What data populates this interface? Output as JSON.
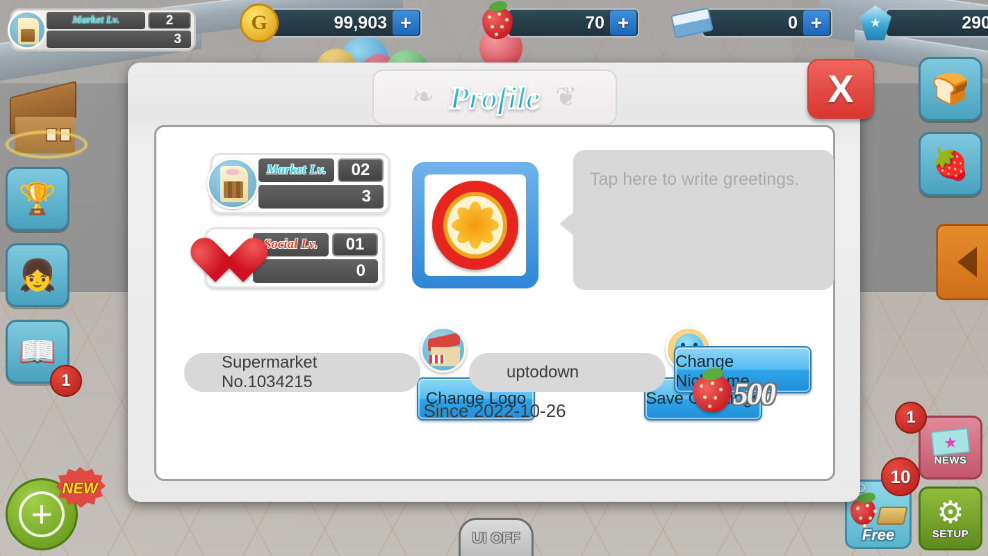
{
  "hud": {
    "market": {
      "label": "Market Lv.",
      "level": "2",
      "progress": "3",
      "icon": "shopping-bag-icon"
    },
    "currencies": [
      {
        "name": "gold",
        "icon": "gold-coin-icon",
        "value": "99,903",
        "plus": "+"
      },
      {
        "name": "strawberry",
        "icon": "strawberry-icon",
        "value": "70",
        "plus": "+"
      },
      {
        "name": "ticket",
        "icon": "ticket-icon",
        "value": "0",
        "plus": "+"
      },
      {
        "name": "gem",
        "icon": "gem-icon",
        "value": "290"
      }
    ]
  },
  "sidebar_left": [
    {
      "name": "trophy",
      "icon": "trophy-icon",
      "glyph": "🏆"
    },
    {
      "name": "character",
      "icon": "character-icon",
      "glyph": "👧"
    },
    {
      "name": "catalog",
      "icon": "catalog-book-icon",
      "glyph": "📖",
      "badge": "1"
    }
  ],
  "sidebar_right": [
    {
      "name": "bread",
      "icon": "bread-icon",
      "glyph": "🍞"
    },
    {
      "name": "strawberry-girl",
      "icon": "strawberry-girl-icon",
      "glyph": "🍓"
    }
  ],
  "buttons": {
    "news": {
      "label": "NEWS",
      "badge": "1",
      "icon": "envelope-icon"
    },
    "setup": {
      "label": "SETUP",
      "icon": "gear-icon"
    },
    "free": {
      "label": "Free",
      "ad_tag": "AD",
      "badge": "10"
    },
    "new_plus": {
      "badge": "NEW",
      "glyph": "+"
    },
    "ui_off": {
      "label": "UI OFF"
    }
  },
  "dialog": {
    "title": "Profile",
    "close_label": "X",
    "flourish_left": "❧",
    "flourish_right": "❦",
    "levels": [
      {
        "key": "market",
        "icon": "shopping-bag-icon",
        "label": "Market Lv.",
        "level": "02",
        "progress": "3"
      },
      {
        "key": "social",
        "icon": "heart-icon",
        "label": "Social Lv.",
        "level": "01",
        "progress": "0"
      }
    ],
    "logo": {
      "icon": "orange-slice-logo"
    },
    "greetings": {
      "placeholder": "Tap here to write greetings.",
      "value": ""
    },
    "change_logo_label": "Change Logo",
    "save_greetings_label": "Save Greetings",
    "store": {
      "icon": "store-icon",
      "value": "Supermarket No.1034215"
    },
    "nickname": {
      "icon": "smiley-avatar-icon",
      "value": "uptodown"
    },
    "change_nickname": {
      "label": "Change Nickname",
      "cost": "500",
      "cost_icon": "strawberry-icon"
    },
    "since": "Since 2022-10-26"
  }
}
